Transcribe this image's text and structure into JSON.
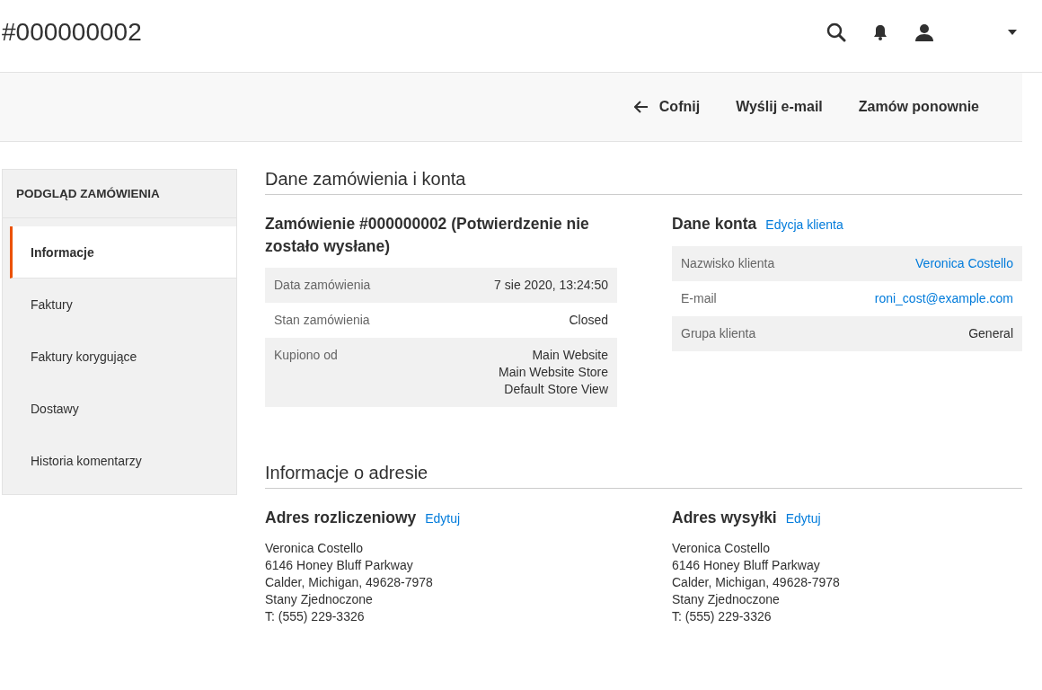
{
  "header": {
    "title": "#000000002"
  },
  "actions": [
    {
      "kind": "back",
      "label": "Cofnij"
    },
    {
      "kind": "plain",
      "label": "Wyślij e-mail"
    },
    {
      "kind": "plain",
      "label": "Zamów ponownie"
    }
  ],
  "sidebar": {
    "title": "PODGLĄD ZAMÓWIENIA",
    "items": [
      {
        "label": "Informacje",
        "selected": true
      },
      {
        "label": "Faktury",
        "selected": false
      },
      {
        "label": "Faktury korygujące",
        "selected": false
      },
      {
        "label": "Dostawy",
        "selected": false
      },
      {
        "label": "Historia komentarzy",
        "selected": false
      }
    ]
  },
  "order_section": {
    "title": "Dane zamówienia i konta",
    "order": {
      "title": "Zamówienie #000000002 (Potwierdzenie nie zostało wysłane)",
      "rows": [
        {
          "label": "Data zamówienia",
          "kind": "text",
          "values": [
            "7 sie 2020, 13:24:50"
          ]
        },
        {
          "label": "Stan zamówienia",
          "kind": "text",
          "values": [
            "Closed"
          ]
        },
        {
          "label": "Kupiono od",
          "kind": "text",
          "values": [
            "Main Website",
            "Main Website Store",
            "Default Store View"
          ]
        }
      ]
    },
    "account": {
      "title": "Dane konta",
      "link": "Edycja klienta",
      "rows": [
        {
          "label": "Nazwisko klienta",
          "kind": "link",
          "values": [
            "Veronica Costello"
          ]
        },
        {
          "label": "E-mail",
          "kind": "link",
          "values": [
            "roni_cost@example.com"
          ]
        },
        {
          "label": "Grupa klienta",
          "kind": "text",
          "values": [
            "General"
          ]
        }
      ]
    }
  },
  "address_section": {
    "title": "Informacje o adresie",
    "addresses": [
      {
        "title": "Adres rozliczeniowy",
        "link": "Edytuj",
        "lines": [
          "Veronica Costello",
          "6146 Honey Bluff Parkway",
          "Calder, Michigan, 49628-7978",
          "Stany Zjednoczone",
          "T: (555) 229-3326"
        ]
      },
      {
        "title": "Adres wysyłki",
        "link": "Edytuj",
        "lines": [
          "Veronica Costello",
          "6146 Honey Bluff Parkway",
          "Calder, Michigan, 49628-7978",
          "Stany Zjednoczone",
          "T: (555) 229-3326"
        ]
      }
    ]
  }
}
